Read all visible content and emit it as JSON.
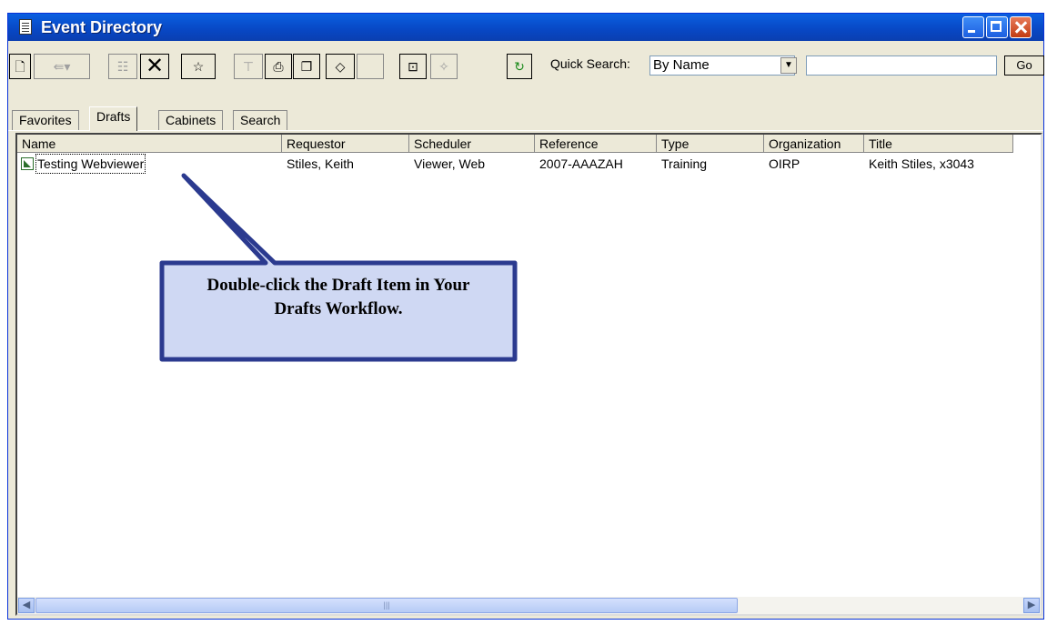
{
  "window": {
    "title": "Event Directory"
  },
  "toolbar": {
    "quick_search_label": "Quick Search:",
    "quick_search_value": "By Name",
    "go_label": "Go"
  },
  "tabs": [
    "Favorites",
    "Drafts",
    "Cabinets",
    "Search"
  ],
  "active_tab": "Drafts",
  "table": {
    "columns": [
      "Name",
      "Requestor",
      "Scheduler",
      "Reference",
      "Type",
      "Organization",
      "Title"
    ],
    "rows": [
      [
        "Testing Webviewer",
        "Stiles, Keith",
        "Viewer, Web",
        "2007-AAAZAH",
        "Training",
        "OIRP",
        "Keith Stiles, x3043"
      ]
    ]
  },
  "callout": {
    "line1": "Double-click the Draft Item in Your",
    "line2": "Drafts Workflow."
  },
  "colors": {
    "title_bar": "#0847c4",
    "callout_border": "#2b3a8f",
    "callout_fill": "#cfd8f3"
  }
}
